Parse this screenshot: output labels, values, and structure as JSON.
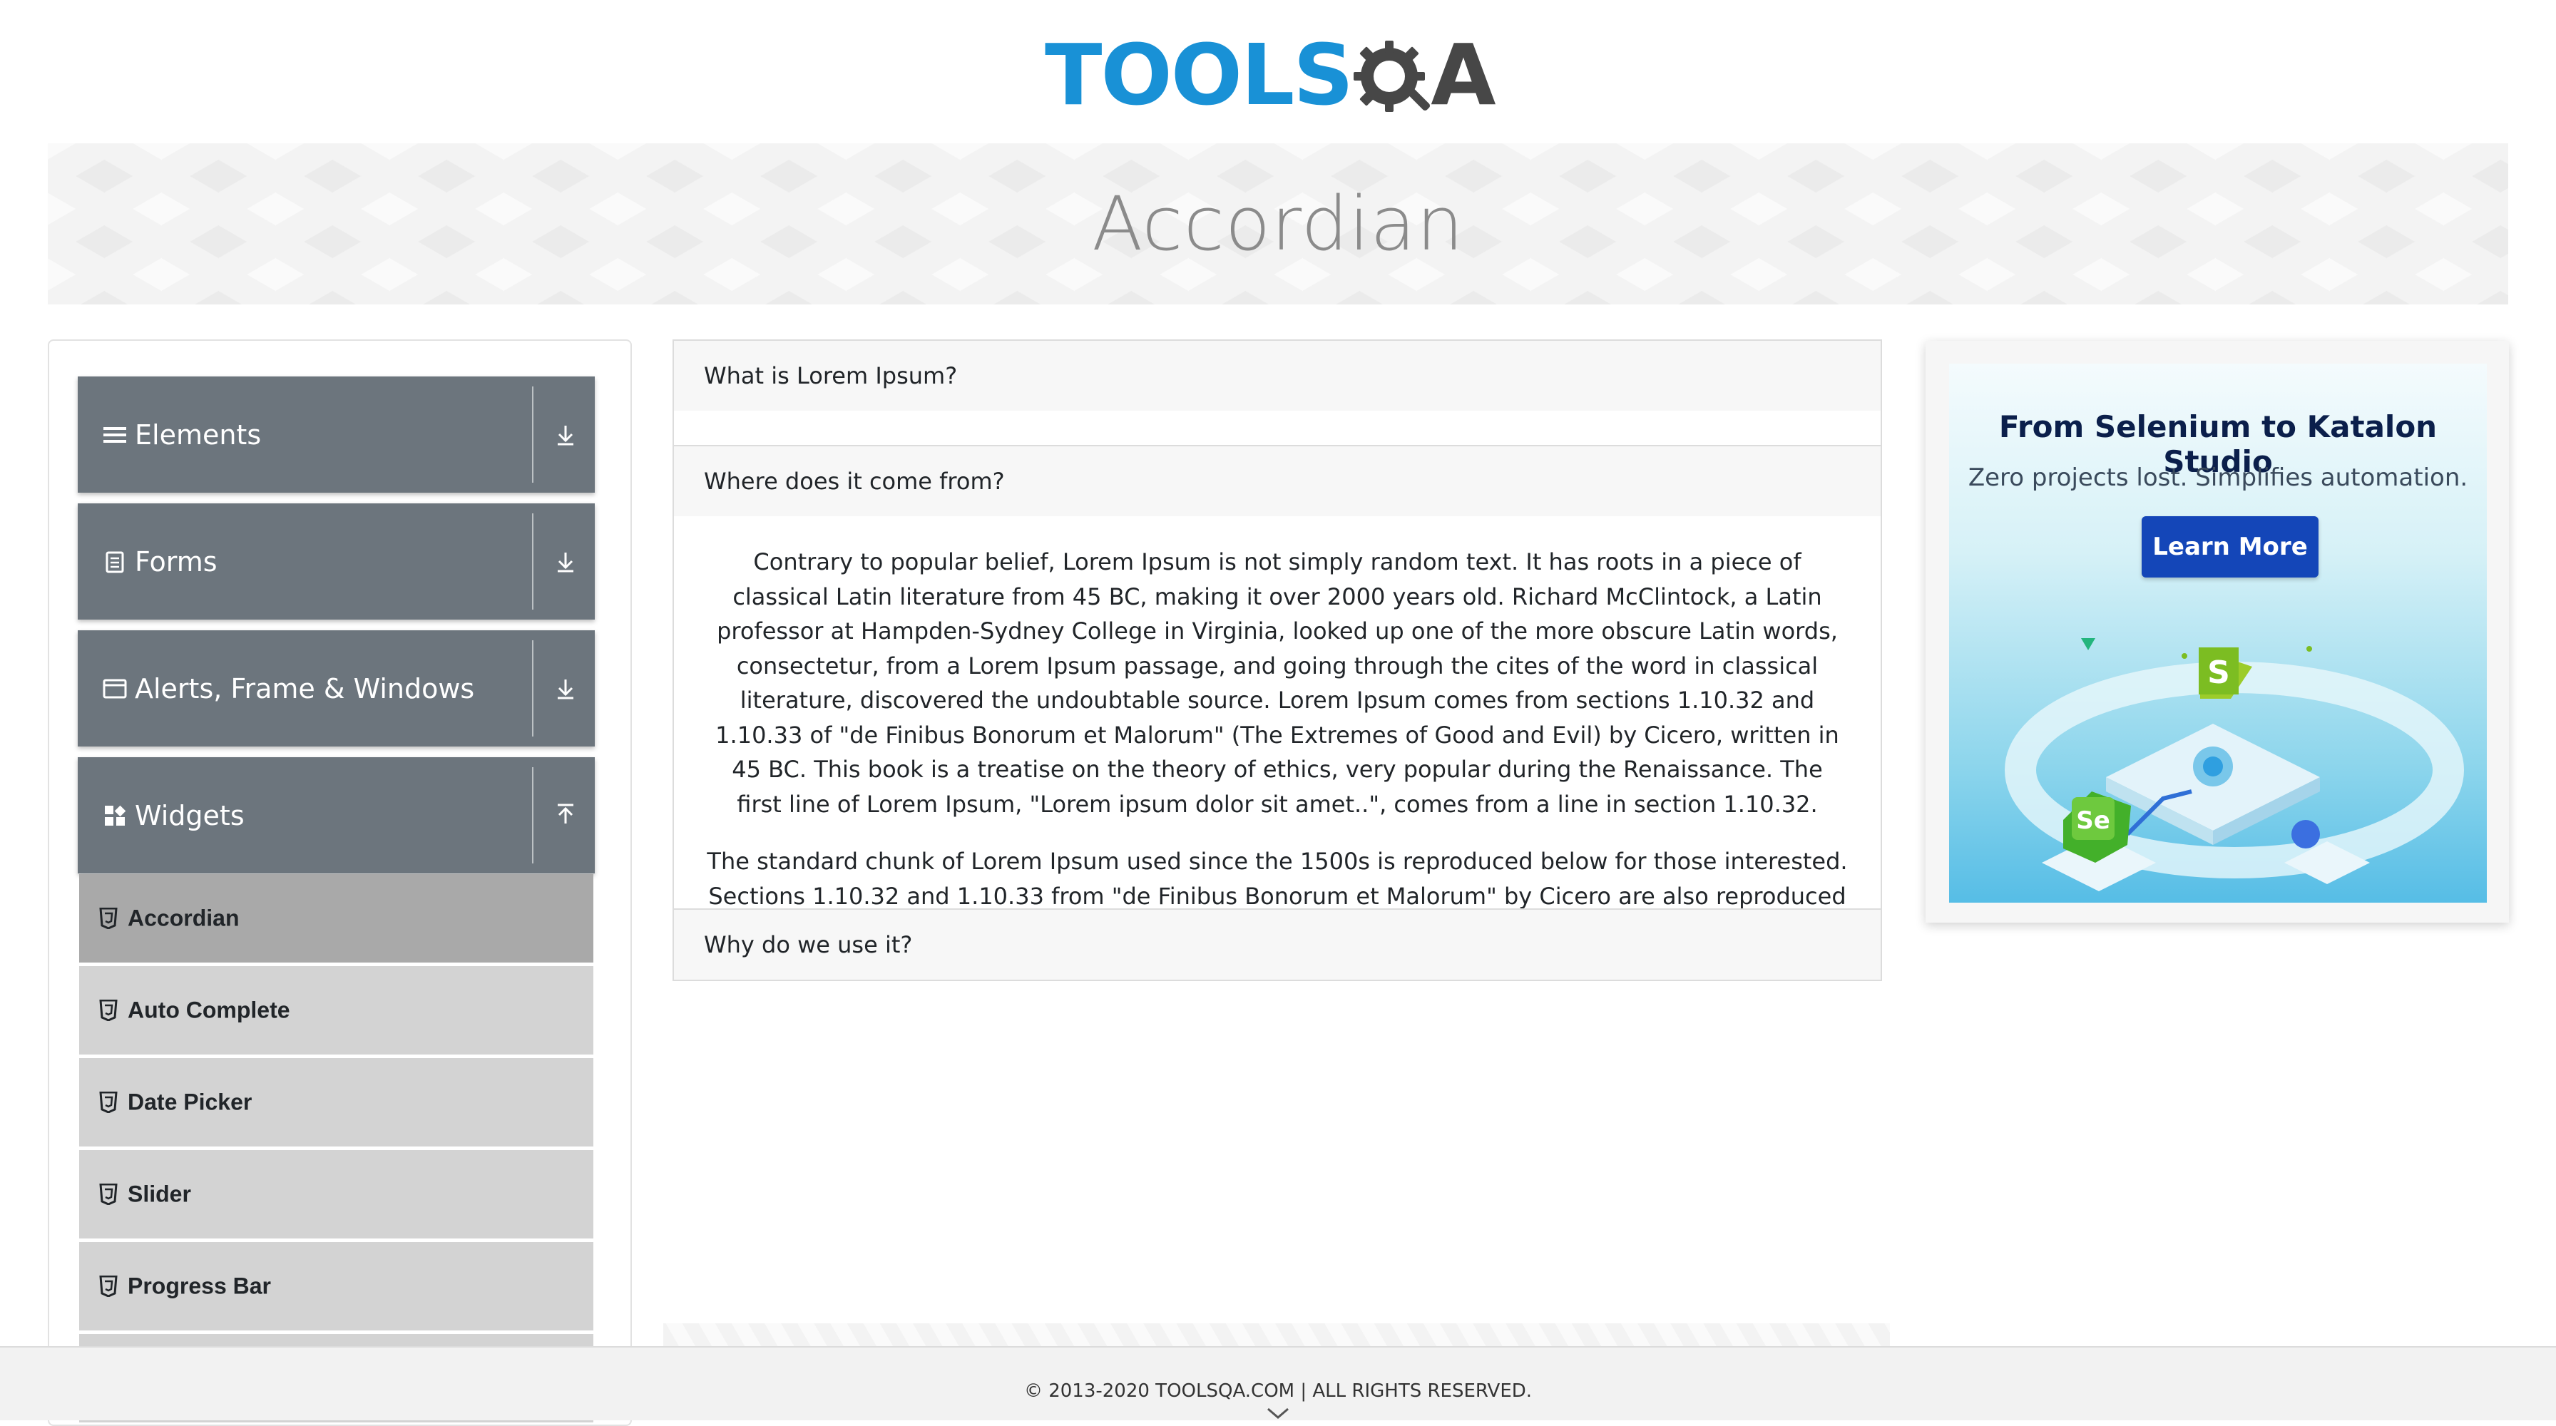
{
  "header": {
    "logo_text": "TOOLS",
    "logo_letter": "A",
    "logo_alt": "TOOLSQA"
  },
  "banner": {
    "title": "Accordian"
  },
  "sidebar": {
    "groups": [
      {
        "label": "Elements",
        "icon": "hamburger-icon",
        "state": "collapsed"
      },
      {
        "label": "Forms",
        "icon": "form-icon",
        "state": "collapsed"
      },
      {
        "label": "Alerts, Frame & Windows",
        "icon": "window-icon",
        "state": "collapsed"
      },
      {
        "label": "Widgets",
        "icon": "widgets-icon",
        "state": "expanded"
      }
    ],
    "items": [
      {
        "label": "Accordian",
        "active": true
      },
      {
        "label": "Auto Complete",
        "active": false
      },
      {
        "label": "Date Picker",
        "active": false
      },
      {
        "label": "Slider",
        "active": false
      },
      {
        "label": "Progress Bar",
        "active": false
      }
    ]
  },
  "accordion": {
    "sections": [
      {
        "heading": "What is Lorem Ipsum?",
        "expanded": false
      },
      {
        "heading": "Where does it come from?",
        "expanded": true,
        "paragraphs": [
          "Contrary to popular belief, Lorem Ipsum is not simply random text. It has roots in a piece of classical Latin literature from 45 BC, making it over 2000 years old. Richard McClintock, a Latin professor at Hampden-Sydney College in Virginia, looked up one of the more obscure Latin words, consectetur, from a Lorem Ipsum passage, and going through the cites of the word in classical literature, discovered the undoubtable source. Lorem Ipsum comes from sections 1.10.32 and 1.10.33 of \"de Finibus Bonorum et Malorum\" (The Extremes of Good and Evil) by Cicero, written in 45 BC. This book is a treatise on the theory of ethics, very popular during the Renaissance. The first line of Lorem Ipsum, \"Lorem ipsum dolor sit amet..\", comes from a line in section 1.10.32.",
          "The standard chunk of Lorem Ipsum used since the 1500s is reproduced below for those interested. Sections 1.10.32 and 1.10.33 from \"de Finibus Bonorum et Malorum\" by Cicero are also reproduced in their exact original form, accompanied by English versions from the 1914 translation by H. Rackham."
        ]
      },
      {
        "heading": "Why do we use it?",
        "expanded": false
      }
    ]
  },
  "ad": {
    "title": "From Selenium to Katalon Studio",
    "subtitle": "Zero projects lost. Simplifies automation.",
    "button": "Learn More",
    "badge_s": "S",
    "badge_se": "Se"
  },
  "footer": {
    "copyright": "© 2013-2020 TOOLSQA.COM | ALL RIGHTS RESERVED."
  },
  "colors": {
    "logo_blue": "#1991d6",
    "logo_dark": "#474747",
    "group_bg": "#6c757d",
    "item_bg": "#d3d3d3",
    "item_active_bg": "#a9a9a9",
    "ad_button": "#1446b8"
  }
}
